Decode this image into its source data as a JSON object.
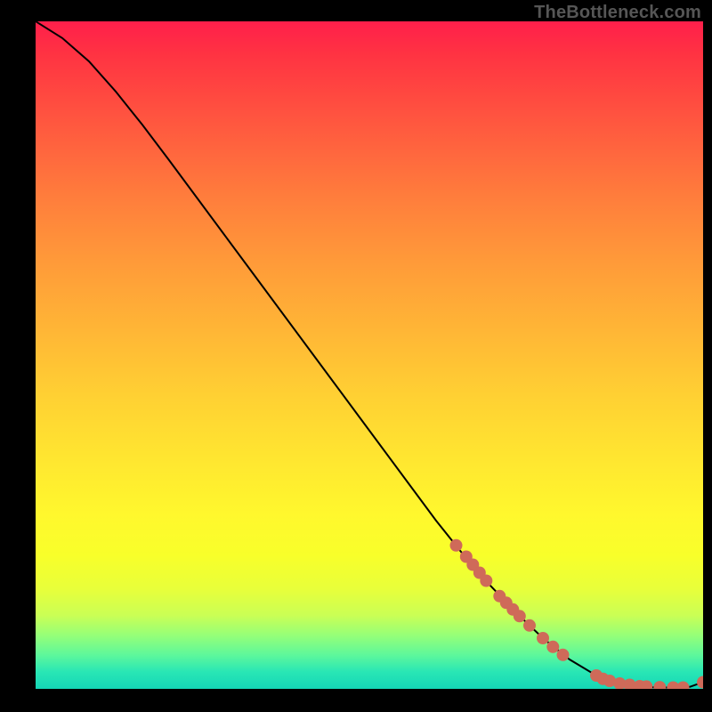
{
  "attribution": "TheBottleneck.com",
  "chart_data": {
    "type": "line",
    "title": "",
    "xlabel": "",
    "ylabel": "",
    "xlim": [
      0,
      100
    ],
    "ylim": [
      0,
      100
    ],
    "grid": false,
    "legend": false,
    "series": [
      {
        "name": "curve",
        "x": [
          0,
          4,
          8,
          12,
          16,
          20,
          24,
          28,
          32,
          36,
          40,
          44,
          48,
          52,
          56,
          60,
          64,
          68,
          72,
          76,
          80,
          84,
          86,
          88,
          90,
          92,
          94,
          96,
          98,
          100
        ],
        "y": [
          100,
          97.5,
          94,
          89.5,
          84.5,
          79.2,
          73.8,
          68.4,
          63,
          57.6,
          52.2,
          46.8,
          41.4,
          36,
          30.6,
          25.2,
          20.2,
          15.6,
          11.4,
          7.6,
          4.4,
          2,
          1.2,
          0.7,
          0.4,
          0.25,
          0.2,
          0.2,
          0.3,
          1.0
        ]
      }
    ],
    "markers": [
      {
        "x": 63.0,
        "y": 21.5
      },
      {
        "x": 64.5,
        "y": 19.8
      },
      {
        "x": 65.5,
        "y": 18.6
      },
      {
        "x": 66.5,
        "y": 17.4
      },
      {
        "x": 67.5,
        "y": 16.2
      },
      {
        "x": 69.5,
        "y": 13.9
      },
      {
        "x": 70.5,
        "y": 12.9
      },
      {
        "x": 71.5,
        "y": 11.9
      },
      {
        "x": 72.5,
        "y": 10.9
      },
      {
        "x": 74.0,
        "y": 9.5
      },
      {
        "x": 76.0,
        "y": 7.6
      },
      {
        "x": 77.5,
        "y": 6.3
      },
      {
        "x": 79.0,
        "y": 5.1
      },
      {
        "x": 84.0,
        "y": 2.0
      },
      {
        "x": 85.0,
        "y": 1.5
      },
      {
        "x": 86.0,
        "y": 1.2
      },
      {
        "x": 87.5,
        "y": 0.8
      },
      {
        "x": 89.0,
        "y": 0.6
      },
      {
        "x": 90.5,
        "y": 0.4
      },
      {
        "x": 91.5,
        "y": 0.35
      },
      {
        "x": 93.5,
        "y": 0.25
      },
      {
        "x": 95.5,
        "y": 0.2
      },
      {
        "x": 97.0,
        "y": 0.2
      },
      {
        "x": 100.0,
        "y": 1.0
      }
    ],
    "marker_color": "#cf6a59",
    "line_color": "#000000"
  }
}
